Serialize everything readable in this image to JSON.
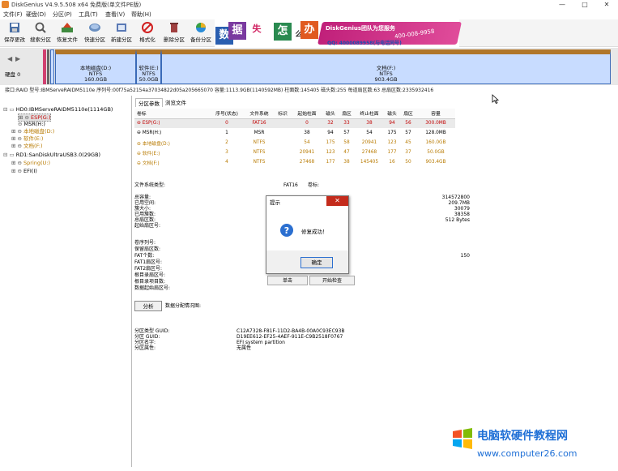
{
  "window": {
    "title": "DiskGenius V4.9.5.508 x64 免费版(单文件PE版)"
  },
  "menu": [
    "文件(F)",
    "硬盘(D)",
    "分区(P)",
    "工具(T)",
    "查看(V)",
    "帮助(H)"
  ],
  "toolbar": [
    "保存更改",
    "搜索分区",
    "恢复文件",
    "快速分区",
    "新建分区",
    "格式化",
    "删除分区",
    "备份分区"
  ],
  "banner": {
    "chars": [
      "数",
      "据",
      "失",
      "怎",
      "么",
      "办"
    ],
    "brand": "DiskGenius团队为您服务",
    "phone": "400-008-9958",
    "qq": "QQ: 4000089958(与电话同号)"
  },
  "disk_nav": {
    "label": "硬盘 0"
  },
  "partitions": [
    {
      "name": "本地磁盘(D:)",
      "fs": "NTFS",
      "size": "160.0GB"
    },
    {
      "name": "软件(E:)",
      "fs": "NTFS",
      "size": "50.0GB"
    },
    {
      "name": "文档(F:)",
      "fs": "NTFS",
      "size": "903.4GB"
    }
  ],
  "disk_info": "接口:RAID  型号:IBMServeRAIDM5110e  序列号:00f75a52154a37034822d05a205665070  容量:1113.9GB(1140592MB)  柱面数:145405  磁头数:255  每道扇区数:63  总扇区数:2335932416",
  "tree": [
    "HD0:IBMServeRAIDM5110e(1114GB)",
    "ESP(G:)",
    "MSR(H:)",
    "本地磁盘(D:)",
    "软件(E:)",
    "文档(F:)",
    "RD1:SanDiskUltraUSB3.0(29GB)",
    "Spring(U:)",
    "EFI(I)"
  ],
  "tabs": [
    "分区参数",
    "浏览文件"
  ],
  "table": {
    "headers": [
      "卷标",
      "序号(状态)",
      "文件系统",
      "标识",
      "起始柱面",
      "磁头",
      "扇区",
      "终止柱面",
      "磁头",
      "扇区",
      "容量"
    ],
    "rows": [
      [
        "ESP(G:)",
        "0",
        "FAT16",
        "",
        "0",
        "32",
        "33",
        "38",
        "94",
        "56",
        "300.0MB"
      ],
      [
        "MSR(H:)",
        "1",
        "MSR",
        "",
        "38",
        "94",
        "57",
        "54",
        "175",
        "57",
        "128.0MB"
      ],
      [
        "本地磁盘(D:)",
        "2",
        "NTFS",
        "",
        "54",
        "175",
        "58",
        "20941",
        "123",
        "45",
        "160.0GB"
      ],
      [
        "软件(E:)",
        "3",
        "NTFS",
        "",
        "20941",
        "123",
        "47",
        "27468",
        "177",
        "37",
        "50.0GB"
      ],
      [
        "文档(F:)",
        "4",
        "NTFS",
        "",
        "27468",
        "177",
        "38",
        "145405",
        "16",
        "50",
        "903.4GB"
      ]
    ]
  },
  "details": {
    "fs_type_label": "文件系统类型:",
    "fs_type_value": "FAT16",
    "vol_label": "卷标:",
    "left_labels": [
      "总容量:",
      "已用空间:",
      "簇大小:",
      "已用簇数:",
      "总扇区数:",
      "起始扇区号:"
    ],
    "right_values": [
      "314572800",
      "209.7MB",
      "30079",
      "38358",
      "512 Bytes"
    ],
    "left_labels2": [
      "卷序列号:",
      "保留扇区数:",
      "FAT个数:",
      "FAT1扇区号:",
      "FAT2扇区号:",
      "根目录扇区号:",
      "根目录项目数:",
      "数据起始扇区号:"
    ],
    "fat_count": "150",
    "analyze_button": "分析",
    "analyze_label": "数据分配情况图:",
    "guid_labels": [
      "分区类型 GUID:",
      "分区 GUID:",
      "分区名字:",
      "分区属性:"
    ],
    "guid_values": [
      "C12A7328-F81F-11D2-BA4B-00A0C93EC93B",
      "D19EE612-EF25-4AEF-911E-C9B2518F0767",
      "EFI system partition",
      "无属性"
    ],
    "hidden_buttons": [
      "单击",
      "开始检查"
    ]
  },
  "dialog": {
    "title": "提示",
    "message": "修复成功！",
    "ok": "确定"
  },
  "watermark": {
    "cn": "电脑软硬件教程网",
    "url": "www.computer26.com"
  },
  "colors": {
    "disk_bar": "#3a6ab8",
    "partition_fill": "#c8dcff",
    "accent_orange": "#b87a00",
    "accent_red": "#c00000",
    "watermark": "#1e6fd6"
  }
}
